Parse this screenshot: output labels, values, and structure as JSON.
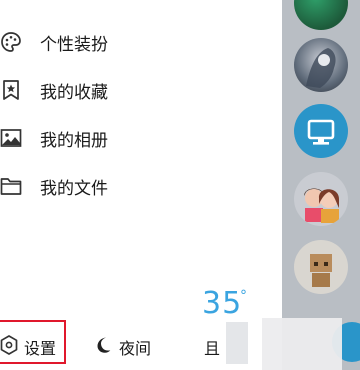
{
  "menu": {
    "items": [
      {
        "label": "个性装扮",
        "icon": "palette-icon"
      },
      {
        "label": "我的收藏",
        "icon": "bookmark-star-icon"
      },
      {
        "label": "我的相册",
        "icon": "photo-album-icon"
      },
      {
        "label": "我的文件",
        "icon": "folder-icon"
      }
    ]
  },
  "bottom_bar": {
    "settings_label": "设置",
    "night_label": "夜间",
    "third_label_partial": "且"
  },
  "weather": {
    "temperature": "35",
    "degree_symbol": "°"
  },
  "colors": {
    "highlight": "#e0182c",
    "weather_text": "#3aa4e0",
    "right_panel": "#b9bec4"
  }
}
